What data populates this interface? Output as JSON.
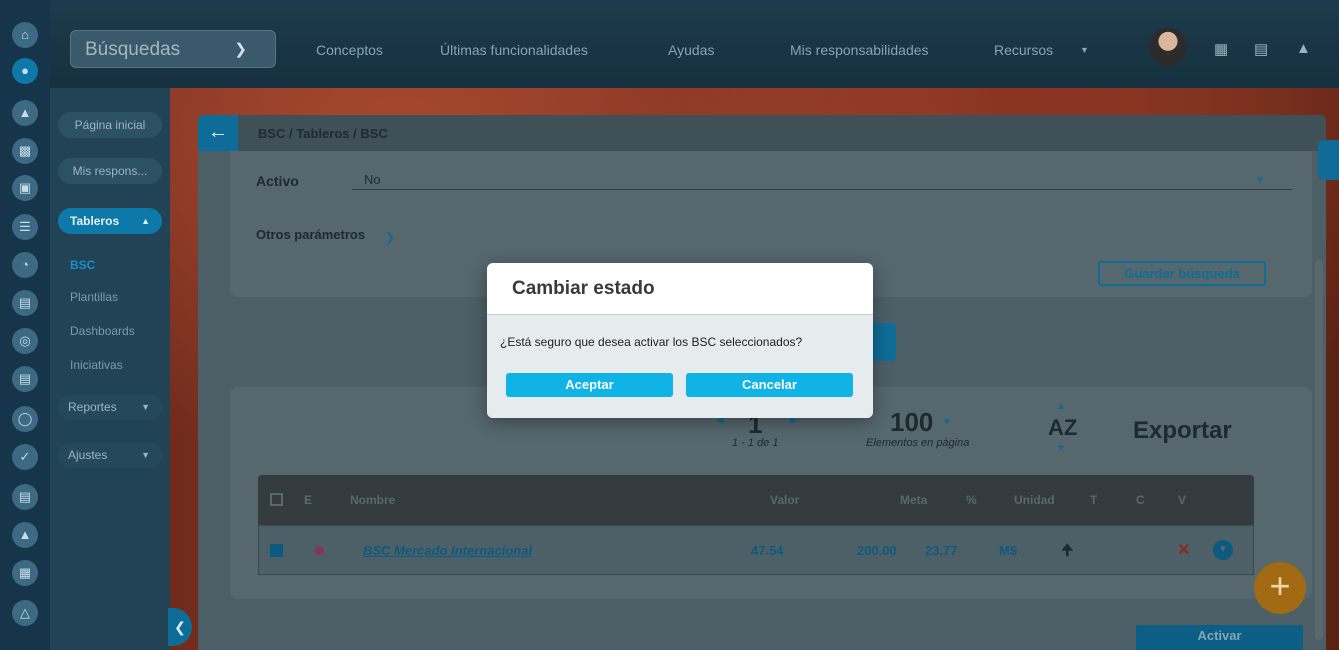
{
  "topbar": {
    "search_label": "Búsquedas",
    "nav": [
      "Conceptos",
      "Últimas funcionalidades",
      "Ayudas",
      "Mis responsabilidades",
      "Recursos"
    ]
  },
  "sidebar": {
    "items": [
      {
        "label": "Página inicial"
      },
      {
        "label": "Mis respons..."
      },
      {
        "label": "Tableros"
      }
    ],
    "links": [
      "BSC",
      "Plantillas",
      "Dashboards",
      "Iniciativas"
    ],
    "reportes": "Reportes",
    "ajustes": "Ajustes"
  },
  "breadcrumb": "BSC / Tableros / BSC",
  "filters": {
    "activo_label": "Activo",
    "activo_value": "No",
    "otros": "Otros parámetros",
    "guardar": "Guardar búsqueda"
  },
  "pager": {
    "page": "1",
    "range": "1 - 1 de 1",
    "per_page": "100",
    "per_page_label": "Elementos en página",
    "sort": "AZ",
    "export": "Exportar"
  },
  "table": {
    "headers": {
      "e": "E",
      "nombre": "Nombre",
      "valor": "Valor",
      "meta": "Meta",
      "pct": "%",
      "unidad": "Unidad",
      "t": "T",
      "c": "C",
      "v": "V"
    },
    "rows": [
      {
        "nombre": "BSC Mercado Internacional",
        "valor": "47.54",
        "meta": "200.00",
        "pct": "23.77",
        "unidad": "M$"
      }
    ]
  },
  "actions": {
    "activar": "Activar"
  },
  "modal": {
    "title": "Cambiar estado",
    "message": "¿Está seguro que desea activar los BSC seleccionados?",
    "accept": "Aceptar",
    "cancel": "Cancelar"
  }
}
